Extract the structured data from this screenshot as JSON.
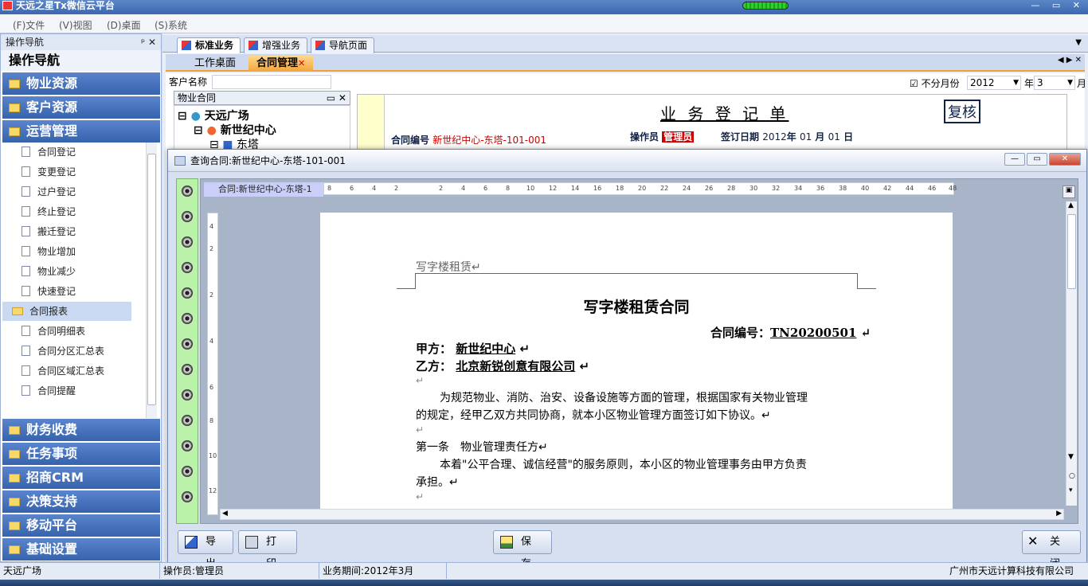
{
  "app": {
    "title": "天远之星Tx微信云平台"
  },
  "menu": [
    "(F)文件",
    "(V)视图",
    "(D)桌面",
    "(S)系统"
  ],
  "nav": {
    "header": "操作导航",
    "title": "操作导航",
    "categories_top": [
      "物业资源",
      "客户资源",
      "运营管理"
    ],
    "sub_items": [
      "合同登记",
      "变更登记",
      "过户登记",
      "终止登记",
      "搬迁登记",
      "物业增加",
      "物业减少",
      "快速登记"
    ],
    "report_folder": "合同报表",
    "report_items": [
      "合同明细表",
      "合同分区汇总表",
      "合同区域汇总表",
      "合同提醒"
    ],
    "categories_bottom": [
      "财务收费",
      "任务事项",
      "招商CRM",
      "决策支持",
      "移动平台",
      "基础设置"
    ]
  },
  "tabs_main": [
    "标准业务",
    "增强业务",
    "导航页面"
  ],
  "tabs_doc": [
    "工作桌面",
    "合同管理"
  ],
  "form": {
    "customer_label": "客户名称",
    "property_contract_label": "物业合同",
    "no_month_label": "不分月份",
    "year_value": "2012",
    "year_label": "年",
    "month_value": "3",
    "month_label": "月",
    "tree": [
      "天远广场",
      "新世纪中心",
      "东塔"
    ]
  },
  "bg_doc": {
    "title": "业 务 登 记 单",
    "review": "复核",
    "contract_no_label": "合同编号",
    "contract_no_value": "新世纪中心-东塔-101-001",
    "operator_label": "操作员",
    "operator_value": "管理员",
    "sign_date_label": "签订日期",
    "sign_year": "2012",
    "year": "年",
    "sign_month": "01",
    "month": "月",
    "sign_day": "01",
    "day": "日"
  },
  "dialog": {
    "title": "查询合同:新世纪中心-东塔-101-001",
    "ruler_label": "合同:新世纪中心-东塔-1",
    "ruler_ticks": [
      "8",
      "6",
      "4",
      "2",
      "2",
      "4",
      "6",
      "8",
      "10",
      "12",
      "14",
      "16",
      "18",
      "20",
      "22",
      "24",
      "26",
      "28",
      "30",
      "32",
      "34",
      "36",
      "38",
      "40",
      "42",
      "44",
      "46",
      "48"
    ],
    "vruler_ticks": [
      "4",
      "2",
      "2",
      "4",
      "6",
      "8",
      "10",
      "12"
    ],
    "buttons": {
      "export": "导 出",
      "print": "打 印",
      "save": "保 存",
      "close": "关 闭"
    }
  },
  "doc": {
    "header_text": "写字楼租赁↵",
    "title": "写字楼租赁合同",
    "contract_no_label": "合同编号：",
    "contract_no": "TN20200501",
    "party_a_label": "甲方：",
    "party_a": "新世纪中心",
    "party_b_label": "乙方：",
    "party_b": "北京新锐创意有限公司",
    "para1": "为规范物业、消防、治安、设备设施等方面的管理，根据国家有关物业管理",
    "para1b": "的规定，经甲乙双方共同协商，就本小区物业管理方面签订如下协议。↵",
    "article1": "第一条　物业管理责任方↵",
    "para2": "本着\"公平合理、诚信经营\"的服务原则，本小区的物业管理事务由甲方负责",
    "para2b": "承担。↵",
    "para_mark": "↵"
  },
  "status": {
    "location": "天远广场",
    "operator": "操作员:管理员",
    "period": "业务期间:2012年3月",
    "company": "广州市天远计算科技有限公司"
  }
}
